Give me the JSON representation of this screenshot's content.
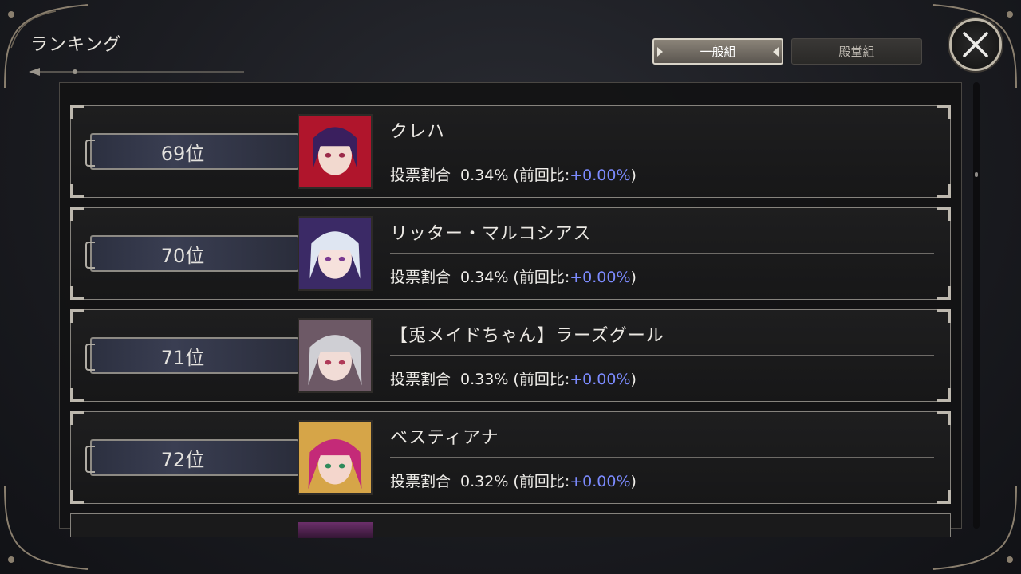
{
  "header": {
    "title": "ランキング"
  },
  "tabs": [
    {
      "label": "一般組",
      "active": true
    },
    {
      "label": "殿堂組",
      "active": false
    }
  ],
  "close_icon": "close-icon",
  "stat_label": "投票割合",
  "rankings": [
    {
      "rank": "69位",
      "name": "クレハ",
      "share": "0.34%",
      "delta_prefix": "(前回比:",
      "delta": "+0.00%",
      "delta_suffix": ")",
      "portrait_colors": [
        "#3a1f5e",
        "#b0152c"
      ]
    },
    {
      "rank": "70位",
      "name": "リッター・マルコシアス",
      "share": "0.34%",
      "delta_prefix": "(前回比:",
      "delta": "+0.00%",
      "delta_suffix": ")",
      "portrait_colors": [
        "#dfe6f2",
        "#3b2a66"
      ]
    },
    {
      "rank": "71位",
      "name": "【兎メイドちゃん】ラーズグール",
      "share": "0.33%",
      "delta_prefix": "(前回比:",
      "delta": "+0.00%",
      "delta_suffix": ")",
      "portrait_colors": [
        "#cfcfd4",
        "#6d5966"
      ]
    },
    {
      "rank": "72位",
      "name": "ベスティアナ",
      "share": "0.32%",
      "delta_prefix": "(前回比:",
      "delta": "+0.00%",
      "delta_suffix": ")",
      "portrait_colors": [
        "#b8206a",
        "#d6a548"
      ]
    }
  ],
  "colors": {
    "delta": "#7c8bff",
    "accent": "#bdb8ae"
  }
}
